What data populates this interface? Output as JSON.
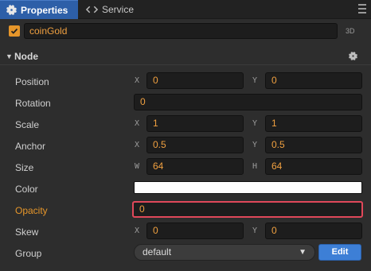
{
  "tabs": [
    {
      "label": "Properties",
      "icon": "gear-icon",
      "active": true
    },
    {
      "label": "Service",
      "icon": "code-icon",
      "active": false
    }
  ],
  "node_name": "coinGold",
  "enabled": true,
  "mode_label": "3D",
  "section": {
    "title": "Node"
  },
  "props": {
    "position": {
      "label": "Position",
      "x_axis": "X",
      "x": "0",
      "y_axis": "Y",
      "y": "0"
    },
    "rotation": {
      "label": "Rotation",
      "value": "0"
    },
    "scale": {
      "label": "Scale",
      "x_axis": "X",
      "x": "1",
      "y_axis": "Y",
      "y": "1"
    },
    "anchor": {
      "label": "Anchor",
      "x_axis": "X",
      "x": "0.5",
      "y_axis": "Y",
      "y": "0.5"
    },
    "size": {
      "label": "Size",
      "w_axis": "W",
      "w": "64",
      "h_axis": "H",
      "h": "64"
    },
    "color": {
      "label": "Color",
      "value_hex": "#ffffff"
    },
    "opacity": {
      "label": "Opacity",
      "value": "0"
    },
    "skew": {
      "label": "Skew",
      "x_axis": "X",
      "x": "0",
      "y_axis": "Y",
      "y": "0"
    },
    "group": {
      "label": "Group",
      "selected": "default",
      "edit_label": "Edit"
    }
  },
  "colors": {
    "accent_blue": "#2d5fa8",
    "value_orange": "#f0a040",
    "focus_red": "#e0485a",
    "edit_blue": "#3d7fd6"
  }
}
